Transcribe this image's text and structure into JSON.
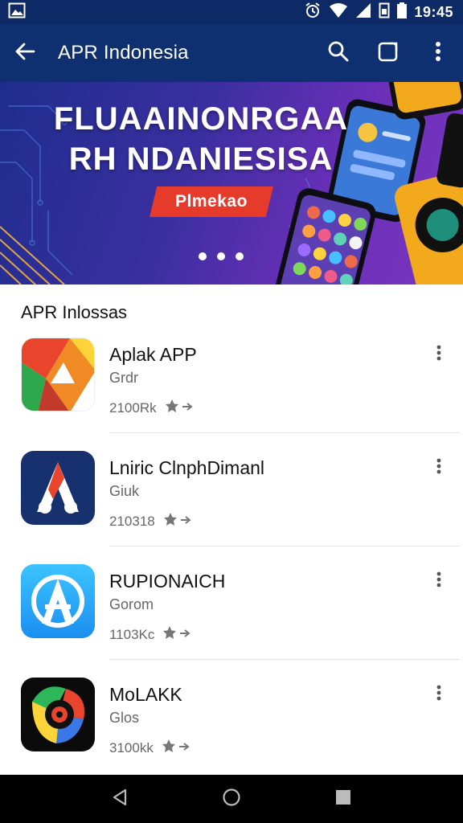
{
  "status_bar": {
    "time": "19:45",
    "icons": [
      "image-icon",
      "alarm-icon",
      "wifi-icon",
      "signal-icon",
      "sim-icon",
      "battery-icon"
    ]
  },
  "app_bar": {
    "title": "APR Indonesia",
    "icons": [
      "back-arrow-icon",
      "search-icon",
      "open-external-icon",
      "more-vert-icon"
    ]
  },
  "banner": {
    "line1": "FLUAAINONRGAA",
    "line2": "RH NDANIESISA",
    "button_label": "Plmekao",
    "page_dots": 3,
    "accent_color": "#e63a2a"
  },
  "section": {
    "title": "APR Inlossas"
  },
  "apps": [
    {
      "name": "Aplak APP",
      "category": "Grdr",
      "meta": "2100Rk",
      "icon": "app-icon-orange-fold"
    },
    {
      "name": "Lniric ClnphDimanl",
      "category": "Giuk",
      "meta": "210318",
      "icon": "app-icon-navy-a"
    },
    {
      "name": "RUPIONAICH",
      "category": "Gorom",
      "meta": "1103Kc",
      "icon": "app-icon-blue-a"
    },
    {
      "name": "MoLAKK",
      "category": "Glos",
      "meta": "3100kk",
      "icon": "app-icon-colorful-pin"
    }
  ],
  "nav_bar": {
    "icons": [
      "back-triangle-icon",
      "home-circle-icon",
      "recents-square-icon"
    ]
  },
  "colors": {
    "app_bar": "#0e2f70",
    "status_bar": "#0d2a66"
  }
}
